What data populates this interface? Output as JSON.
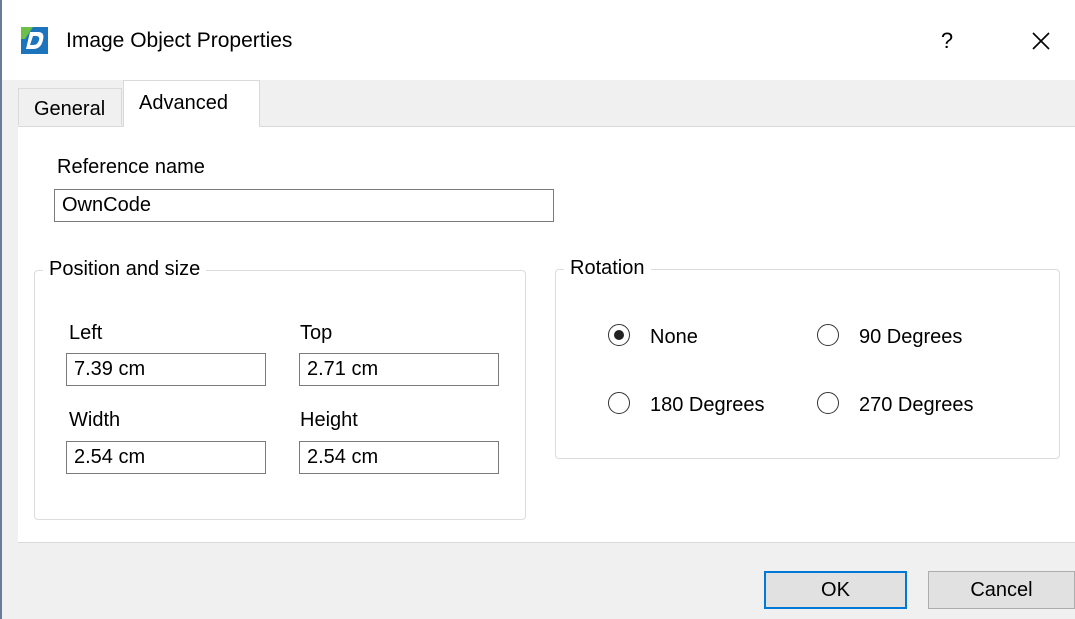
{
  "window": {
    "title": "Image Object Properties",
    "help_label": "?",
    "icon": "app-d-icon",
    "close_icon": "close-icon"
  },
  "tabs": [
    {
      "label": "General",
      "selected": false
    },
    {
      "label": "Advanced",
      "selected": true
    }
  ],
  "reference": {
    "label": "Reference name",
    "value": "OwnCode"
  },
  "position_size": {
    "caption": "Position and size",
    "left_label": "Left",
    "left_value": "7.39 cm",
    "top_label": "Top",
    "top_value": "2.71 cm",
    "width_label": "Width",
    "width_value": "2.54 cm",
    "height_label": "Height",
    "height_value": "2.54 cm"
  },
  "rotation": {
    "caption": "Rotation",
    "options": [
      {
        "label": "None",
        "selected": true
      },
      {
        "label": "90 Degrees",
        "selected": false
      },
      {
        "label": "180 Degrees",
        "selected": false
      },
      {
        "label": "270 Degrees",
        "selected": false
      }
    ]
  },
  "buttons": {
    "ok": "OK",
    "cancel": "Cancel"
  },
  "colors": {
    "accent": "#0078d7",
    "icon_blue": "#1c75bc",
    "icon_green": "#6cc04a"
  }
}
